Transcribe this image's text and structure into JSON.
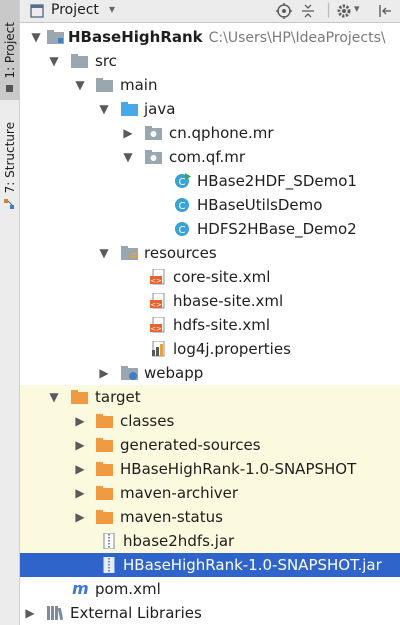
{
  "side": {
    "project_tab": "1: Project",
    "structure_tab": "7: Structure"
  },
  "header": {
    "title": "Project"
  },
  "tree": {
    "root_name": "HBaseHighRank",
    "root_path": "C:\\Users\\HP\\IdeaProjects\\",
    "src": "src",
    "main": "main",
    "java": "java",
    "pkg1": "cn.qphone.mr",
    "pkg2": "com.qf.mr",
    "class1": "HBase2HDF_SDemo1",
    "class2": "HBaseUtilsDemo",
    "class3": "HDFS2HBase_Demo2",
    "resources": "resources",
    "res1": "core-site.xml",
    "res2": "hbase-site.xml",
    "res3": "hdfs-site.xml",
    "res4": "log4j.properties",
    "webapp": "webapp",
    "target": "target",
    "t1": "classes",
    "t2": "generated-sources",
    "t3": "HBaseHighRank-1.0-SNAPSHOT",
    "t4": "maven-archiver",
    "t5": "maven-status",
    "jar1": "hbase2hdfs.jar",
    "jar2": "HBaseHighRank-1.0-SNAPSHOT.jar",
    "pom": "pom.xml",
    "ext": "External Libraries"
  }
}
